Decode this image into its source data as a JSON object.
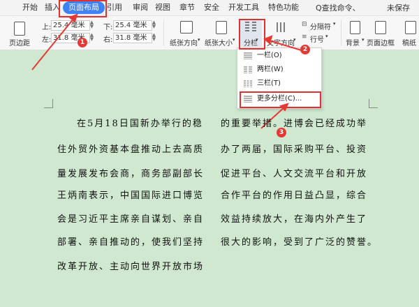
{
  "tabs": [
    "开始",
    "插入",
    "页面布局",
    "引用",
    "审阅",
    "视图",
    "章节",
    "安全",
    "开发工具",
    "特色功能"
  ],
  "search_label": "Q查找命令、",
  "unsaved_label": "未保存",
  "ribbon": {
    "margin_label": "页边距",
    "top_label": "上:",
    "top_value": "25.4 毫米",
    "bottom_label": "下:",
    "bottom_value": "25.4 毫米",
    "left_label": "左:",
    "left_value": "31.8 毫米",
    "right_label": "右:",
    "right_value": "31.8 毫米",
    "orientation_label": "纸张方向",
    "size_label": "纸张大小",
    "columns_label": "分栏",
    "text_direction_label": "文字方向",
    "separator_label": "分隔符",
    "line_number_label": "行号",
    "background_label": "背景",
    "page_border_label": "页面边框",
    "draft_label": "稿纸"
  },
  "dropdown": {
    "items": [
      "一栏(O)",
      "两栏(W)",
      "三栏(T)",
      "更多分栏(C)..."
    ]
  },
  "badges": [
    "1",
    "2",
    "3"
  ],
  "document": {
    "left_column": [
      "在5月18日国新办举行的稳",
      "住外贸外资基本盘推动上去高质",
      "量发展发布会商，商务部副部长",
      "王炳南表示，中国国际进口博览",
      "会是习近平主席亲自谋划、亲自",
      "部署、亲自推动的，使我们坚持",
      "改革开放、主动向世界开放市场"
    ],
    "right_column": [
      "的重要举措。进博会已经成功举",
      "办了两届，国际采购平台、投资",
      "促进平台、人文交流平台和开放",
      "合作平台的作用日益凸显，综合",
      "效益持续放大，在海内外产生了",
      "很大的影响，受到了广泛的赞誉。"
    ]
  },
  "colors": {
    "accent": "#3e82f6",
    "annotation_red": "#e03030",
    "page_background": "#cfe8cf"
  }
}
